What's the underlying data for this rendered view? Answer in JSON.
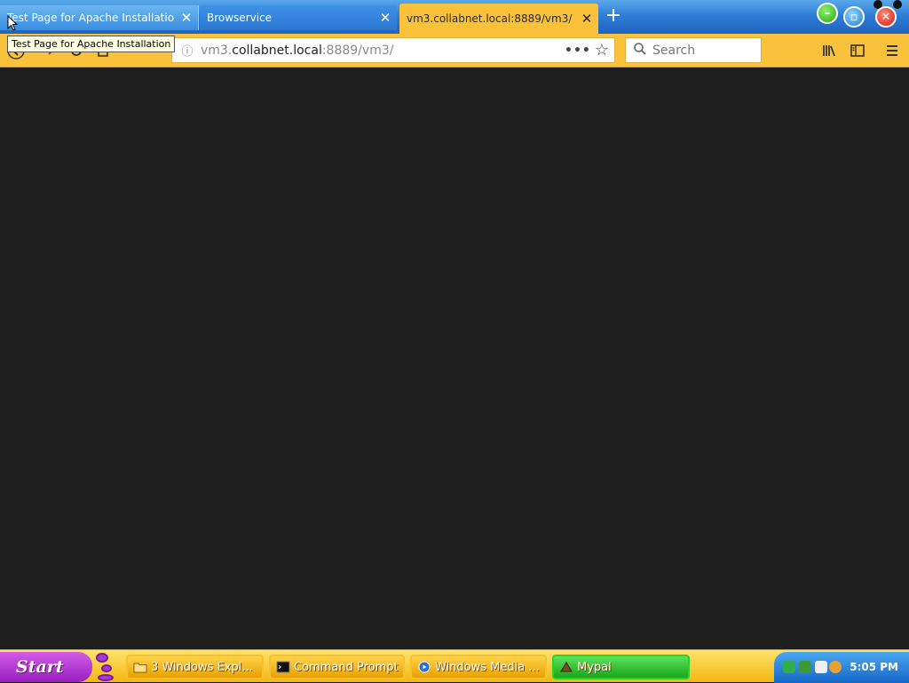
{
  "browser": {
    "tabs": [
      {
        "label": "Test Page for Apache Installation",
        "active": false
      },
      {
        "label": "Browservice",
        "active": false
      },
      {
        "label": "vm3.collabnet.local:8889/vm3/",
        "active": true
      }
    ],
    "close_glyph": "✕",
    "new_tab_glyph": "+",
    "tooltip": "Test Page for Apache Installation",
    "url": {
      "prefix": "vm3.",
      "host": "collabnet.local",
      "suffix": ":8889/vm3/"
    },
    "search_placeholder": "Search",
    "icons": [
      "back-icon",
      "forward-icon",
      "reload-icon",
      "home-icon",
      "info-icon",
      "more-icon",
      "star-icon",
      "library-icon",
      "sidebar-icon",
      "menu-icon",
      "search-icon"
    ]
  },
  "taskbar": {
    "start_label": "Start",
    "tasks": [
      {
        "label": "3 Windows Expl...",
        "icon": "folder-icon"
      },
      {
        "label": "Command Prompt",
        "icon": "cmd-icon"
      },
      {
        "label": "Windows Media ...",
        "icon": "media-player-icon"
      },
      {
        "label": "Mypal",
        "icon": "mypal-icon"
      }
    ],
    "clock": "5:05 PM"
  },
  "colors": {
    "tabstrip": "#2e7fd6",
    "active_tab": "#f9c23a",
    "content_bg": "#1e1e1e",
    "taskbar": "#f2b710",
    "start": "#9a1fbf"
  }
}
